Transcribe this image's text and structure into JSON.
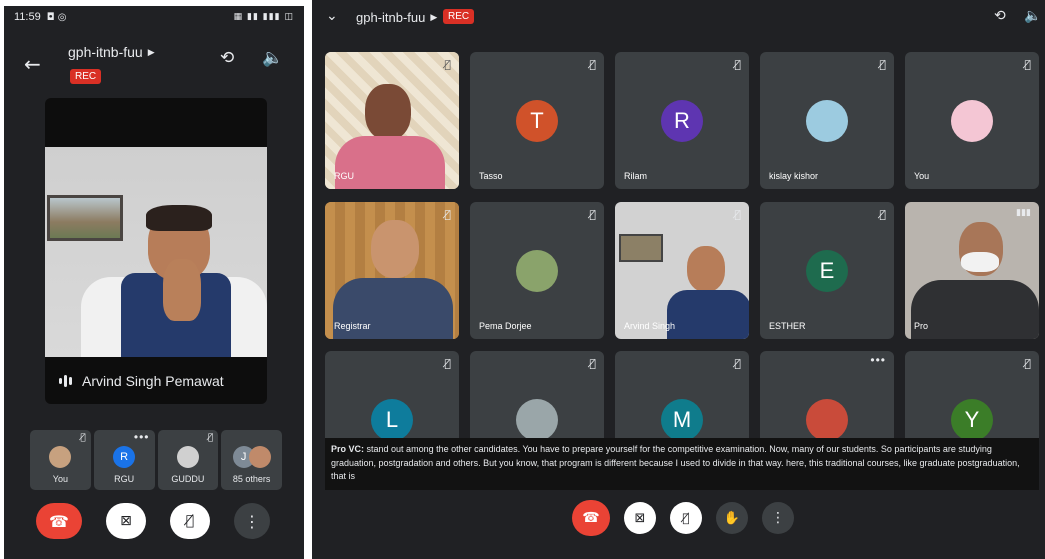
{
  "phone": {
    "status": {
      "time": "11:59",
      "left_icons": "◘ ◎",
      "right_icons": "▦ ▮▮ ▮▮▮ ◫"
    },
    "meeting_code": "gph-itnb-fuu",
    "rec_label": "REC",
    "main_speaker": "Arvind Singh Pemawat",
    "thumbnails": [
      {
        "label": "You",
        "avatar_color": "#c7a17f",
        "initial": ""
      },
      {
        "label": "RGU",
        "avatar_color": "#1a73e8",
        "initial": "R"
      },
      {
        "label": "GUDDU",
        "avatar_color": "#d0d0d0",
        "initial": ""
      },
      {
        "label": "85 others",
        "avatar_color": "#7e8a96",
        "initial": "J"
      }
    ]
  },
  "meet": {
    "meeting_code": "gph-itnb-fuu",
    "rec_label": "REC",
    "participants": [
      {
        "name": "RGU",
        "type": "video",
        "bg": "#e8dcc8"
      },
      {
        "name": "Tasso",
        "type": "initial",
        "initial": "T",
        "color": "#d0522a"
      },
      {
        "name": "Rilam",
        "type": "initial",
        "initial": "R",
        "color": "#5e35b1"
      },
      {
        "name": "kislay kishor",
        "type": "photo",
        "color": "#9ccbe0"
      },
      {
        "name": "You",
        "type": "photo",
        "color": "#f4c6d4"
      },
      {
        "name": "Registrar",
        "type": "video",
        "bg": "#c99a5a"
      },
      {
        "name": "Pema Dorjee",
        "type": "photo",
        "color": "#8aa36b"
      },
      {
        "name": "Arvind Singh",
        "type": "video",
        "bg": "#d2d2d2"
      },
      {
        "name": "ESTHER",
        "type": "initial",
        "initial": "E",
        "color": "#1e6b4e"
      },
      {
        "name": "Pro",
        "type": "video",
        "bg": "#b9b4ae"
      },
      {
        "name": "",
        "type": "initial",
        "initial": "L",
        "color": "#0e7c9c"
      },
      {
        "name": "",
        "type": "photo",
        "color": "#9aa6a9"
      },
      {
        "name": "",
        "type": "initial",
        "initial": "M",
        "color": "#0f7c8c"
      },
      {
        "name": "",
        "type": "photo",
        "color": "#c94b3a"
      },
      {
        "name": "",
        "type": "initial",
        "initial": "Y",
        "color": "#3b7d28"
      }
    ],
    "caption": {
      "speaker": "Pro VC:",
      "text": "stand out among the other candidates. You have to prepare yourself for the competitive examination. Now, many of our students. So participants are studying graduation, postgradation and others. But you know, that program is different because I used to divide in that way. here, this traditional courses, like graduate postgraduation, that is"
    }
  },
  "colors": {
    "end_call": "#ea4335",
    "control_dark": "#3c4043",
    "control_light": "#ffffff",
    "rec": "#d93025"
  }
}
